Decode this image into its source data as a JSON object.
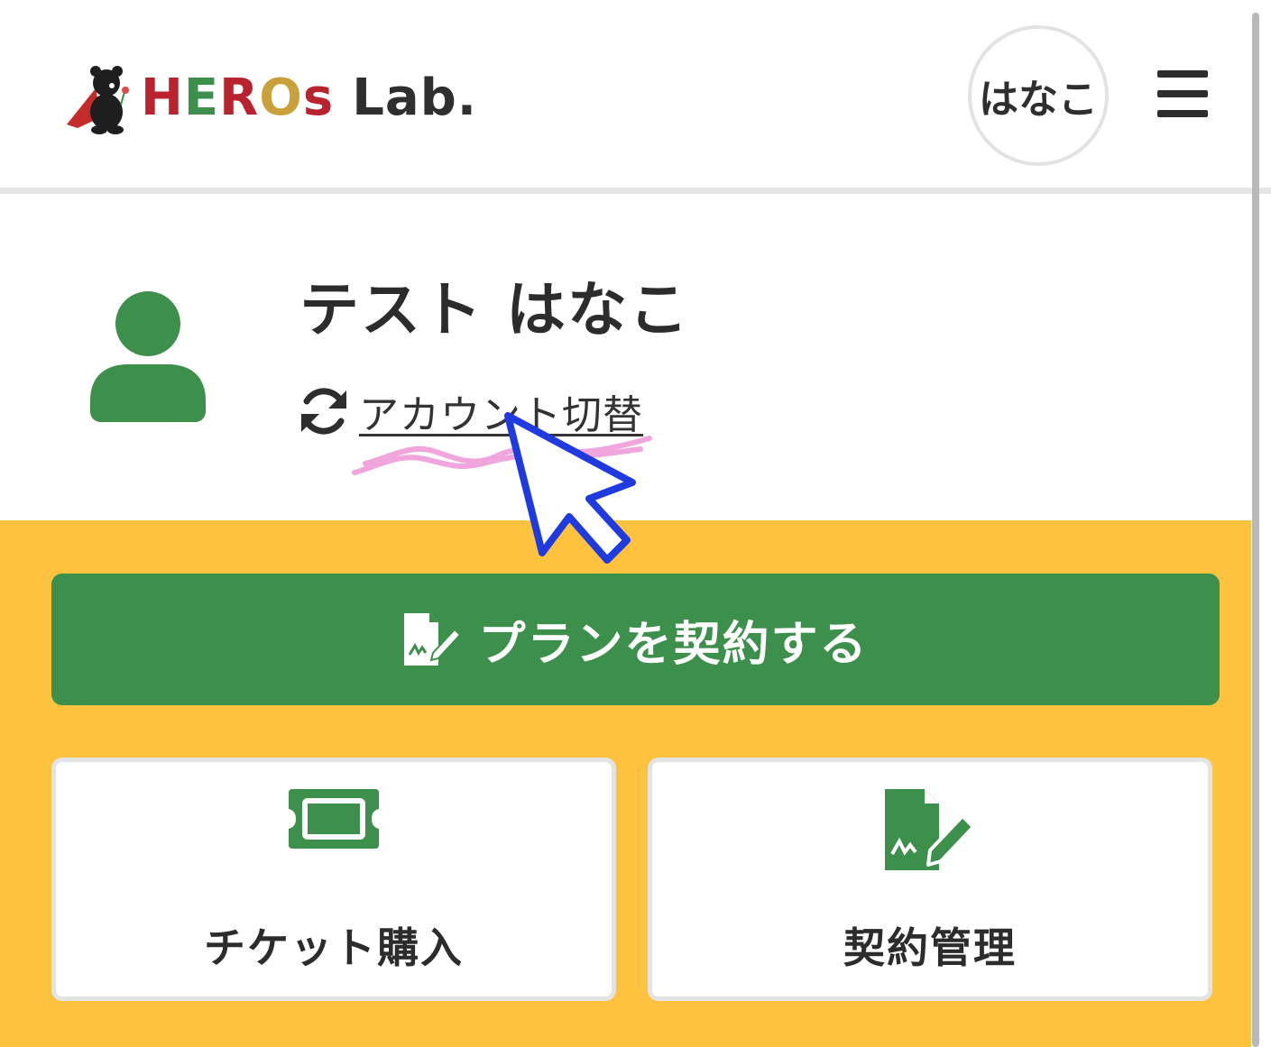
{
  "header": {
    "logo_letters": [
      "H",
      "E",
      "R",
      "O",
      "s"
    ],
    "logo_colors": [
      "#b8232f",
      "#3d8f4c",
      "#b8232f",
      "#c9a13b",
      "#b8232f"
    ],
    "logo_suffix": "Lab.",
    "user_initial_label": "はなこ",
    "menu_icon": "hamburger-icon"
  },
  "profile": {
    "name": "テスト はなこ",
    "switch_account_label": "アカウント切替",
    "switch_icon": "refresh-icon",
    "avatar_icon": "person-icon"
  },
  "actions": {
    "contract_plan_label": "プランを契約する",
    "contract_plan_icon": "contract-sign-icon",
    "cards": [
      {
        "label": "チケット購入",
        "icon": "ticket-icon"
      },
      {
        "label": "契約管理",
        "icon": "contract-sign-icon"
      }
    ]
  },
  "colors": {
    "brand_green": "#3d8f4c",
    "accent_yellow": "#fdc33e",
    "cursor_blue": "#1f3be0",
    "highlight_pink": "#f0a6dc"
  }
}
